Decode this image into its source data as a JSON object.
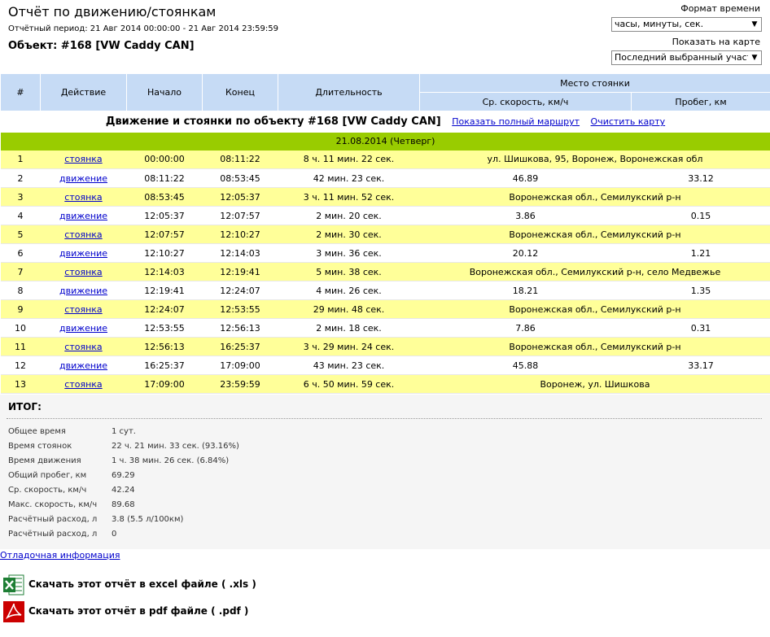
{
  "header": {
    "title": "Отчёт по движению/стоянкам",
    "period": "Отчётный период: 21 Авг 2014 00:00:00 - 21 Авг 2014 23:59:59",
    "object": "Объект: #168 [VW Caddy CAN]",
    "time_format_label": "Формат времени",
    "time_format_value": "часы, минуты, сек.",
    "show_on_map_label": "Показать на карте",
    "show_on_map_value": "Последний выбранный участок"
  },
  "columns": {
    "num": "#",
    "action": "Действие",
    "start": "Начало",
    "end": "Конец",
    "duration": "Длительность",
    "place": "Место стоянки",
    "avg_speed": "Ср. скорость, км/ч",
    "mileage": "Пробег, км"
  },
  "section": {
    "title": "Движение и стоянки по объекту #168 [VW Caddy CAN]",
    "show_route_link": "Показать полный маршрут",
    "clear_map_link": "Очистить карту"
  },
  "date_row": "21.08.2014 (Четверг)",
  "rows": [
    {
      "num": "1",
      "action": "стоянка",
      "start": "00:00:00",
      "end": "08:11:22",
      "duration": "8 ч. 11 мин. 22 сек.",
      "place": "ул. Шишкова, 95, Воронеж, Воронежская обл"
    },
    {
      "num": "2",
      "action": "движение",
      "start": "08:11:22",
      "end": "08:53:45",
      "duration": "42 мин. 23 сек.",
      "speed": "46.89",
      "mileage": "33.12"
    },
    {
      "num": "3",
      "action": "стоянка",
      "start": "08:53:45",
      "end": "12:05:37",
      "duration": "3 ч. 11 мин. 52 сек.",
      "place": "Воронежская обл., Семилукский р-н"
    },
    {
      "num": "4",
      "action": "движение",
      "start": "12:05:37",
      "end": "12:07:57",
      "duration": "2 мин. 20 сек.",
      "speed": "3.86",
      "mileage": "0.15"
    },
    {
      "num": "5",
      "action": "стоянка",
      "start": "12:07:57",
      "end": "12:10:27",
      "duration": "2 мин. 30 сек.",
      "place": "Воронежская обл., Семилукский р-н"
    },
    {
      "num": "6",
      "action": "движение",
      "start": "12:10:27",
      "end": "12:14:03",
      "duration": "3 мин. 36 сек.",
      "speed": "20.12",
      "mileage": "1.21"
    },
    {
      "num": "7",
      "action": "стоянка",
      "start": "12:14:03",
      "end": "12:19:41",
      "duration": "5 мин. 38 сек.",
      "place": "Воронежская обл., Семилукский р-н, село Медвежье"
    },
    {
      "num": "8",
      "action": "движение",
      "start": "12:19:41",
      "end": "12:24:07",
      "duration": "4 мин. 26 сек.",
      "speed": "18.21",
      "mileage": "1.35"
    },
    {
      "num": "9",
      "action": "стоянка",
      "start": "12:24:07",
      "end": "12:53:55",
      "duration": "29 мин. 48 сек.",
      "place": "Воронежская обл., Семилукский р-н"
    },
    {
      "num": "10",
      "action": "движение",
      "start": "12:53:55",
      "end": "12:56:13",
      "duration": "2 мин. 18 сек.",
      "speed": "7.86",
      "mileage": "0.31"
    },
    {
      "num": "11",
      "action": "стоянка",
      "start": "12:56:13",
      "end": "16:25:37",
      "duration": "3 ч. 29 мин. 24 сек.",
      "place": "Воронежская обл., Семилукский р-н"
    },
    {
      "num": "12",
      "action": "движение",
      "start": "16:25:37",
      "end": "17:09:00",
      "duration": "43 мин. 23 сек.",
      "speed": "45.88",
      "mileage": "33.17"
    },
    {
      "num": "13",
      "action": "стоянка",
      "start": "17:09:00",
      "end": "23:59:59",
      "duration": "6 ч. 50 мин. 59 сек.",
      "place": "Воронеж, ул. Шишкова"
    }
  ],
  "summary": {
    "title": "ИТОГ:",
    "items": [
      {
        "label": "Общее время",
        "value": "1 сут."
      },
      {
        "label": "Время стоянок",
        "value": "22 ч. 21 мин. 33 сек. (93.16%)"
      },
      {
        "label": "Время движения",
        "value": "1 ч. 38 мин. 26 сек. (6.84%)"
      },
      {
        "label": "Общий пробег, км",
        "value": "69.29"
      },
      {
        "label": "Ср. скорость, км/ч",
        "value": "42.24"
      },
      {
        "label": "Макс. скорость, км/ч",
        "value": "89.68"
      },
      {
        "label": "Расчётный расход, л",
        "value": "3.8 (5.5 л/100км)"
      },
      {
        "label": "Расчётный расход, л",
        "value": "0"
      }
    ]
  },
  "debug_link": "Отладочная информация",
  "downloads": {
    "excel": "Скачать этот отчёт в excel файле ( .xls )",
    "pdf": "Скачать этот отчёт в pdf файле ( .pdf )"
  },
  "colors": {
    "header_bg": "#c6dbf5",
    "date_bg": "#99cc00",
    "stop_row_bg": "#ffff99",
    "link": "#0000cc",
    "excel_icon": "#1e7e34",
    "pdf_icon": "#cc0000"
  },
  "icons": {
    "excel": "excel-file-icon",
    "pdf": "pdf-file-icon",
    "dropdown": "dropdown-arrow-icon"
  }
}
